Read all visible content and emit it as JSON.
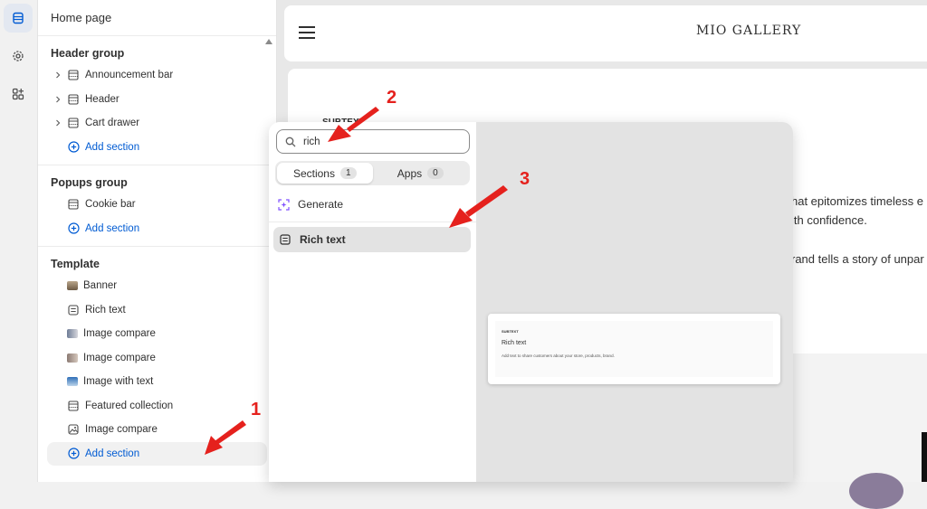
{
  "sidebar_panel": {
    "title": "Home page",
    "header_group": {
      "title": "Header group",
      "items": [
        {
          "label": "Announcement bar",
          "icon": "section-icon"
        },
        {
          "label": "Header",
          "icon": "section-icon"
        },
        {
          "label": "Cart drawer",
          "icon": "section-icon"
        }
      ],
      "add_label": "Add section"
    },
    "popups_group": {
      "title": "Popups group",
      "items": [
        {
          "label": "Cookie bar",
          "icon": "section-icon"
        }
      ],
      "add_label": "Add section"
    },
    "template": {
      "title": "Template",
      "items": [
        {
          "label": "Banner",
          "icon": "image-thumb-icon"
        },
        {
          "label": "Rich text",
          "icon": "text-block-icon"
        },
        {
          "label": "Image compare",
          "icon": "image-thumb-icon"
        },
        {
          "label": "Image compare",
          "icon": "image-thumb-icon"
        },
        {
          "label": "Image with text",
          "icon": "image-thumb-icon"
        },
        {
          "label": "Featured collection",
          "icon": "section-icon"
        },
        {
          "label": "Image compare",
          "icon": "image-outline-icon"
        }
      ],
      "add_label": "Add section"
    }
  },
  "storefront": {
    "brand": "MIO GALLERY",
    "subtext": "SUBTEXT",
    "lines": [
      "hat epitomizes timeless e",
      "ith confidence.",
      "rand tells a story of unpar"
    ]
  },
  "picker": {
    "search_value": "rich",
    "tabs": [
      {
        "label": "Sections",
        "count": "1"
      },
      {
        "label": "Apps",
        "count": "0"
      }
    ],
    "generate_label": "Generate",
    "result_label": "Rich text",
    "preview_card": {
      "eyebrow": "SUBTEXT",
      "title": "Rich text",
      "description": "Add text to share customers about your store, products, brand."
    }
  },
  "annotations": {
    "one": "1",
    "two": "2",
    "three": "3"
  },
  "colors": {
    "accent": "#005bd3",
    "annotation": "#e5211d"
  }
}
